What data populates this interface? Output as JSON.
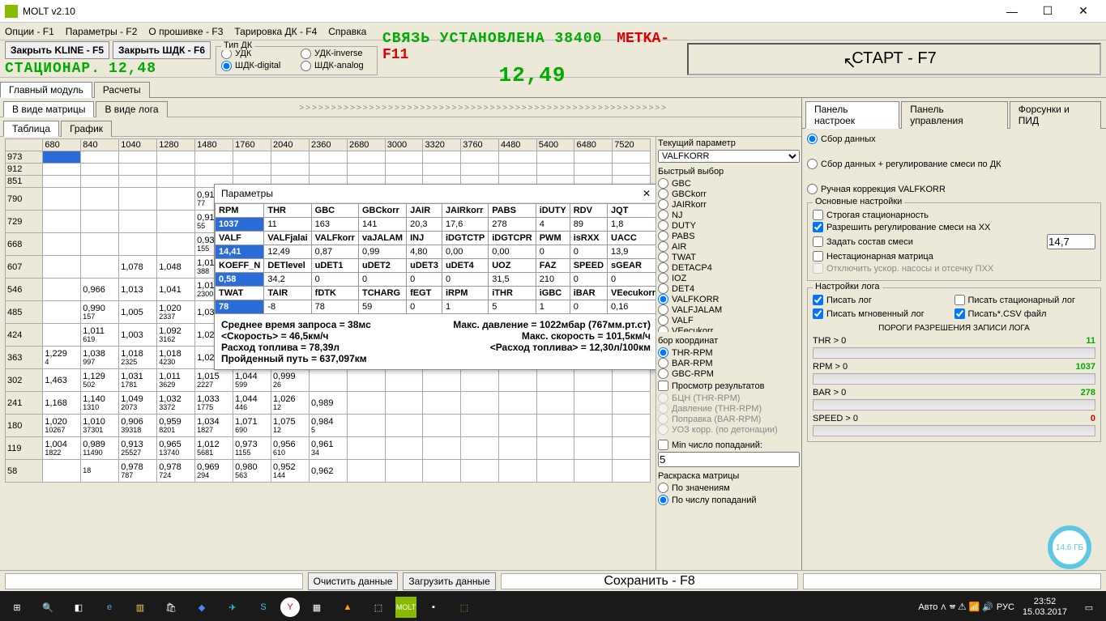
{
  "title": "MOLT v2.10",
  "menu": [
    "Опции - F1",
    "Параметры - F2",
    "О прошивке - F3",
    "Тарировка ДК - F4",
    "Справка"
  ],
  "toolbar": {
    "close_kline": "Закрыть KLINE - F5",
    "close_shdk": "Закрыть ШДК - F6",
    "station": "СТАЦИОНАР.",
    "station_val": "12,48",
    "dk_group": "Тип ДК",
    "dk_opts": [
      "УДК",
      "ШДК-digital",
      "УДК-inverse",
      "ШДК-analog"
    ],
    "conn": "СВЯЗЬ УСТАНОВЛЕНА 38400",
    "metka": "METKA-F11",
    "afr": "12,49",
    "start": "СТАРТ - F7"
  },
  "main_tabs": [
    "Главный модуль",
    "Расчеты"
  ],
  "view_tabs": [
    "В виде матрицы",
    "В виде лога"
  ],
  "sub_tabs": [
    "Таблица",
    "График"
  ],
  "matrix": {
    "cols": [
      "680",
      "840",
      "1040",
      "1280",
      "1480",
      "1760",
      "2040",
      "2360",
      "2680",
      "3000",
      "3320",
      "3760",
      "4480",
      "5400",
      "6480",
      "7520"
    ],
    "rows": [
      "973",
      "912",
      "851",
      "790",
      "729",
      "668",
      "607",
      "546",
      "485",
      "424",
      "363",
      "302",
      "241",
      "180",
      "119",
      "58"
    ]
  },
  "cells": {
    "r790_c1480": {
      "v": "0,914",
      "s": "77"
    },
    "r729_c1480": {
      "v": "0,918",
      "s": "55"
    },
    "r668_c1480": {
      "v": "0,938",
      "s": "155"
    },
    "r607_c1040": {
      "v": "1,078",
      "s": ""
    },
    "r607_c1280": {
      "v": "1,048",
      "s": ""
    },
    "r607_c1480": {
      "v": "1,010",
      "s": "388"
    },
    "r546_c840": {
      "v": "0,966",
      "s": ""
    },
    "r546_c1040": {
      "v": "1,013",
      "s": ""
    },
    "r546_c1280": {
      "v": "1,041",
      "s": ""
    },
    "r546_c1480": {
      "v": "1,010",
      "s": "2300"
    },
    "r485_c840": {
      "v": "0,990",
      "s": "157"
    },
    "r485_c1040": {
      "v": "1,005",
      "s": ""
    },
    "r485_c1280": {
      "v": "1,020",
      "s": "2337"
    },
    "r485_c1480": {
      "v": "1,035",
      "s": ""
    },
    "r424_c840": {
      "v": "1,011",
      "s": "619"
    },
    "r424_c1040": {
      "v": "1,003",
      "s": ""
    },
    "r424_c1280": {
      "v": "1,092",
      "s": "3162"
    },
    "r424_c1480": {
      "v": "1,023",
      "s": ""
    },
    "r363_c680": {
      "v": "1,229",
      "s": "4"
    },
    "r363_c840": {
      "v": "1,038",
      "s": "997"
    },
    "r363_c1040": {
      "v": "1,018",
      "s": "2325"
    },
    "r363_c1280": {
      "v": "1,018",
      "s": "4230"
    },
    "r363_c1480": {
      "v": "1,023",
      "s": ""
    },
    "r302_c680": {
      "v": "1,463",
      "s": ""
    },
    "r302_c840": {
      "v": "1,129",
      "s": "502"
    },
    "r302_c1040": {
      "v": "1,031",
      "s": "1781"
    },
    "r302_c1280": {
      "v": "1,011",
      "s": "3629"
    },
    "r302_c1480": {
      "v": "1,015",
      "s": "2227"
    },
    "r302_c1760": {
      "v": "1,044",
      "s": "599"
    },
    "r302_c2040": {
      "v": "0,999",
      "s": "26"
    },
    "r241_c680": {
      "v": "1,168",
      "s": ""
    },
    "r241_c840": {
      "v": "1,140",
      "s": "1310"
    },
    "r241_c1040": {
      "v": "1,049",
      "s": "2073"
    },
    "r241_c1280": {
      "v": "1,032",
      "s": "3372"
    },
    "r241_c1480": {
      "v": "1,033",
      "s": "1775"
    },
    "r241_c1760": {
      "v": "1,044",
      "s": "446"
    },
    "r241_c2040": {
      "v": "1,026",
      "s": "12"
    },
    "r241_c2360": {
      "v": "0,989",
      "s": ""
    },
    "r180_c680": {
      "v": "1,020",
      "s": "10267"
    },
    "r180_c840": {
      "v": "1,010",
      "s": "37301"
    },
    "r180_c1040": {
      "v": "0,906",
      "s": "39318"
    },
    "r180_c1280": {
      "v": "0,959",
      "s": "8201"
    },
    "r180_c1480": {
      "v": "1,034",
      "s": "1827"
    },
    "r180_c1760": {
      "v": "1,071",
      "s": "690"
    },
    "r180_c2040": {
      "v": "1,075",
      "s": "12"
    },
    "r180_c2360": {
      "v": "0,984",
      "s": "5"
    },
    "r119_c680": {
      "v": "1,004",
      "s": "1822"
    },
    "r119_c840": {
      "v": "0,989",
      "s": "11490"
    },
    "r119_c1040": {
      "v": "0,913",
      "s": "25527"
    },
    "r119_c1280": {
      "v": "0,965",
      "s": "13740"
    },
    "r119_c1480": {
      "v": "1,012",
      "s": "5681"
    },
    "r119_c1760": {
      "v": "0,973",
      "s": "1155"
    },
    "r119_c2040": {
      "v": "0,956",
      "s": "610"
    },
    "r119_c2360": {
      "v": "0,961",
      "s": "34"
    },
    "r58_c840": {
      "v": "",
      "s": "18"
    },
    "r58_c1040": {
      "v": "0,978",
      "s": "787"
    },
    "r58_c1280": {
      "v": "0,978",
      "s": "724"
    },
    "r58_c1480": {
      "v": "0,969",
      "s": "294"
    },
    "r58_c1760": {
      "v": "0,980",
      "s": "563"
    },
    "r58_c2040": {
      "v": "0,952",
      "s": "144"
    },
    "r58_c2360": {
      "v": "0,962",
      "s": ""
    }
  },
  "popup": {
    "title": "Параметры",
    "rows": [
      [
        "RPM",
        "THR",
        "GBC",
        "GBCkorr",
        "JAIR",
        "JAIRkorr",
        "PABS",
        "iDUTY",
        "RDV",
        "JQT"
      ],
      [
        "1037",
        "11",
        "163",
        "141",
        "20,3",
        "17,6",
        "278",
        "4",
        "89",
        "1,8"
      ],
      [
        "VALF",
        "VALFjalai",
        "VALFkorr",
        "vaJALAM",
        "INJ",
        "iDGTCTP",
        "iDGTCPR",
        "PWM",
        "isRXX",
        "UACC"
      ],
      [
        "14,41",
        "12,49",
        "0,87",
        "0,99",
        "4,80",
        "0,00",
        "0,00",
        "0",
        "0",
        "13,9"
      ],
      [
        "KOEFF_N",
        "DETlevel",
        "uDET1",
        "uDET2",
        "uDET3",
        "uDET4",
        "UOZ",
        "FAZ",
        "SPEED",
        "sGEAR"
      ],
      [
        "0,58",
        "34,2",
        "0",
        "0",
        "0",
        "0",
        "31,5",
        "210",
        "0",
        "0"
      ],
      [
        "TWAT",
        "TAIR",
        "fDTK",
        "TCHARG",
        "fEGT",
        "iRPM",
        "iTHR",
        "iGBC",
        "iBAR",
        "VEecukorr"
      ],
      [
        "78",
        "-8",
        "78",
        "59",
        "0",
        "1",
        "5",
        "1",
        "0",
        "0,16"
      ]
    ],
    "footer": [
      [
        "Среднее время запроса = 38мс",
        "Макс. давление = 1022мбар (767мм.рт.ст)"
      ],
      [
        "<Скорость> = 46,5км/ч",
        "Макс. скорость = 101,5км/ч"
      ],
      [
        "Расход топлива = 78,39л",
        "<Расход топлива> = 12,30л/100км"
      ],
      [
        "Пройденный путь = 637,097км",
        ""
      ]
    ]
  },
  "mid": {
    "cur_param": "Текущий параметр",
    "cur_val": "VALFKORR",
    "quick": "Быстрый выбор",
    "quick_opts": [
      "GBC",
      "GBCkorr",
      "JAIRkorr",
      "NJ",
      "DUTY",
      "PABS",
      "AIR",
      "TWAT",
      "DETACP4",
      "IOZ",
      "DET4",
      "VALFKORR",
      "VALFJALAM",
      "VALF",
      "VEecukorr"
    ],
    "axes": "бор координат",
    "axes_opts": [
      "THR-RPM",
      "BAR-RPM",
      "GBC-RPM"
    ],
    "results": "Просмотр результатов",
    "res_opts": [
      "БЦН (THR-RPM)",
      "Давление (THR-RPM)",
      "Поправка (BAR-RPM)",
      "УОЗ корр. (по детонации)"
    ],
    "min_hits": "Min число попаданий:",
    "min_hits_val": "5",
    "colorize": "Раскраска матрицы",
    "color_opts": [
      "По значениям",
      "По числу попаданий"
    ]
  },
  "right_tabs": [
    "Панель настроек",
    "Панель управления",
    "Форсунки и ПИД"
  ],
  "right": {
    "mode_opts": [
      "Сбор данных",
      "Сбор данных + регулирование смеси по ДК",
      "Ручная коррекция VALFKORR"
    ],
    "main_set": "Основные настройки",
    "chk1": "Строгая стационарность",
    "chk2": "Разрешить регулирование смеси на ХХ",
    "chk3": "Задать состав смеси",
    "mix_val": "14,7",
    "chk4": "Нестационарная матрица",
    "chk5": "Отключить ускор. насосы и отсечку ПХХ",
    "log_set": "Настройки лога",
    "log_chk1": "Писать лог",
    "log_chk2": "Писать стационарный лог",
    "log_chk3": "Писать мгновенный лог",
    "log_chk4": "Писать*.CSV файл",
    "thresh": "ПОРОГИ РАЗРЕШЕНИЯ ЗАПИСИ ЛОГА",
    "sliders": [
      {
        "lbl": "THR > 0",
        "val": "11",
        "cls": "val-green"
      },
      {
        "lbl": "RPM > 0",
        "val": "1037",
        "cls": "val-green"
      },
      {
        "lbl": "BAR > 0",
        "val": "278",
        "cls": "val-green"
      },
      {
        "lbl": "SPEED > 0",
        "val": "0",
        "cls": "val-red"
      }
    ]
  },
  "bottom": {
    "clear": "Очистить данные",
    "load": "Загрузить данные",
    "save": "Сохранить - F8"
  },
  "disk": "14.6 ГБ",
  "taskbar": {
    "time": "23:52",
    "date": "15.03.2017",
    "lang": "РУС",
    "auto": "Авто"
  }
}
